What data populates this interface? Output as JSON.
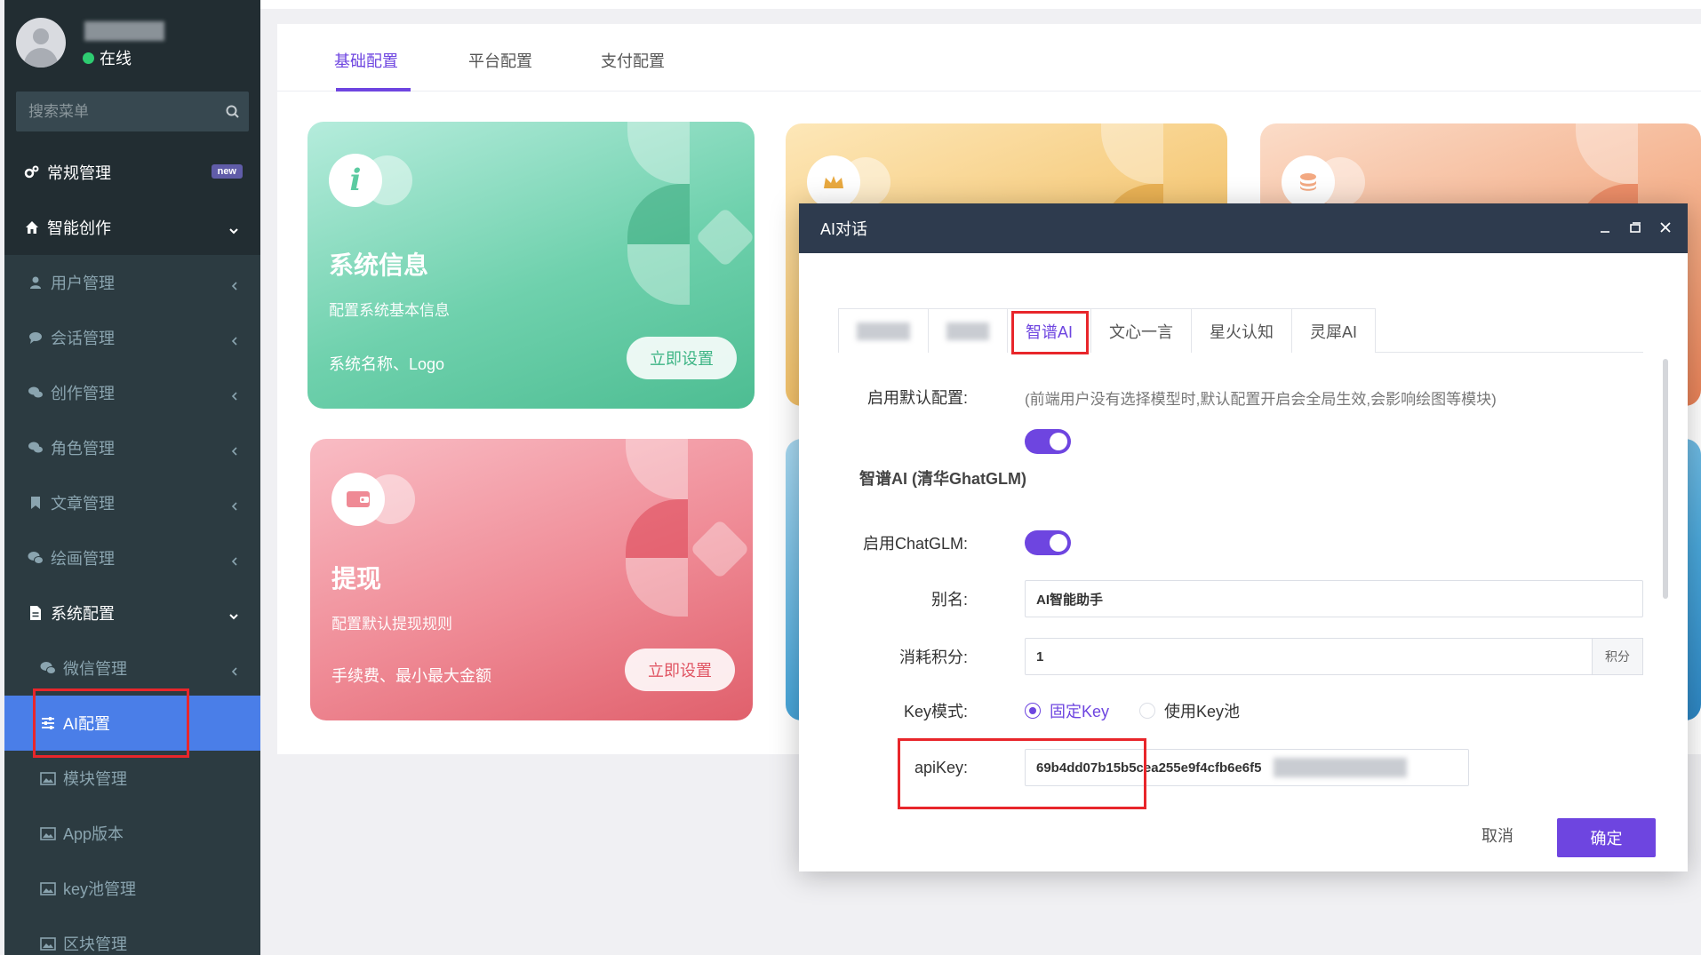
{
  "sidebar": {
    "status_text": "在线",
    "search_placeholder": "搜索菜单",
    "badge_new": "new",
    "items": [
      {
        "label": "常规管理"
      },
      {
        "label": "智能创作"
      },
      {
        "label": "用户管理"
      },
      {
        "label": "会话管理"
      },
      {
        "label": "创作管理"
      },
      {
        "label": "角色管理"
      },
      {
        "label": "文章管理"
      },
      {
        "label": "绘画管理"
      },
      {
        "label": "系统配置"
      },
      {
        "label": "微信管理"
      },
      {
        "label": "AI配置"
      },
      {
        "label": "模块管理"
      },
      {
        "label": "App版本"
      },
      {
        "label": "key池管理"
      },
      {
        "label": "区块管理"
      }
    ]
  },
  "config_tabs": [
    "基础配置",
    "平台配置",
    "支付配置"
  ],
  "cards": {
    "system_info": {
      "title": "系统信息",
      "subtitle": "配置系统基本信息",
      "footer": "系统名称、Logo",
      "button": "立即设置"
    },
    "withdraw": {
      "title": "提现",
      "subtitle": "配置默认提现规则",
      "footer": "手续费、最小最大金额",
      "button": "立即设置"
    }
  },
  "dialog": {
    "title": "AI对话",
    "ai_tabs": [
      "智谱AI",
      "文心一言",
      "星火认知",
      "灵犀AI"
    ],
    "default_config_label": "启用默认配置:",
    "default_config_hint": "(前端用户没有选择模型时,默认配置开启会全局生效,会影响绘图等模块)",
    "section_title": "智谱AI (清华GhatGLM)",
    "enable_chatglm_label": "启用ChatGLM:",
    "alias_label": "别名:",
    "alias_value": "AI智能助手",
    "cost_label": "消耗积分:",
    "cost_value": "1",
    "cost_unit": "积分",
    "key_mode_label": "Key模式:",
    "key_mode_options": [
      "固定Key",
      "使用Key池"
    ],
    "apikey_label": "apiKey:",
    "apikey_value": "69b4dd07b15b5cea255e9f4cfb6e6f5",
    "cancel": "取消",
    "ok": "确定"
  },
  "colors": {
    "accent": "#6e45e0",
    "sidebar_bg": "#222d32",
    "active_menu": "#4a7ee8",
    "dialog_header": "#2e3b4e",
    "highlight": "#e8262b"
  }
}
